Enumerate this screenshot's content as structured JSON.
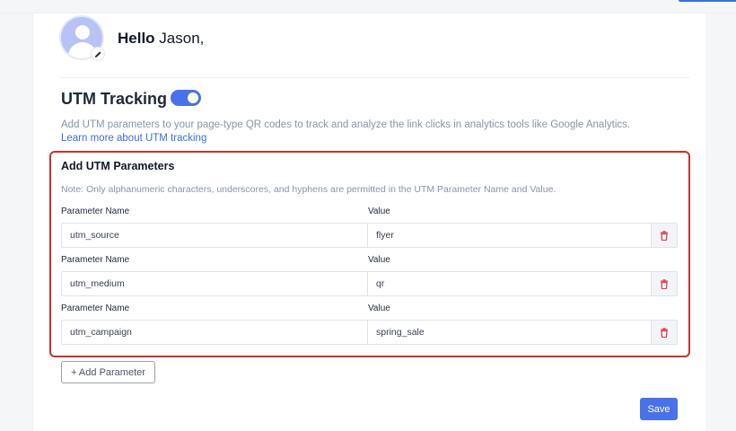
{
  "header": {
    "greeting_bold": "Hello",
    "greeting_name": "Jason,"
  },
  "utm": {
    "title": "UTM Tracking",
    "enabled": true,
    "description": "Add UTM parameters to your page-type QR codes to track and analyze the link clicks in analytics tools like Google Analytics.",
    "learn_more": "Learn more about UTM tracking"
  },
  "params_section": {
    "title": "Add UTM Parameters",
    "note": "Note: Only alphanumeric characters, underscores, and hyphens are permitted in the UTM Parameter Name and Value.",
    "name_label": "Parameter Name",
    "value_label": "Value",
    "rows": [
      {
        "name": "utm_source",
        "value": "flyer"
      },
      {
        "name": "utm_medium",
        "value": "qr"
      },
      {
        "name": "utm_campaign",
        "value": "spring_sale"
      }
    ]
  },
  "actions": {
    "add_parameter": "+ Add Parameter",
    "save": "Save"
  },
  "colors": {
    "accent": "#4a72e8",
    "highlight_border": "#c8312f",
    "delete_icon": "#e0424f"
  }
}
